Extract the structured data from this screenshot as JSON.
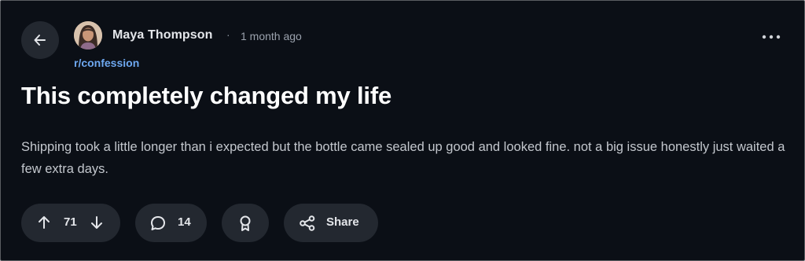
{
  "post": {
    "author": "Maya Thompson",
    "separator": "·",
    "time_ago": "1 month ago",
    "subreddit": "r/confession",
    "title": "This completely changed my life",
    "body": "Shipping took a little longer than i expected but the bottle came sealed up good and looked fine. not a big issue honestly just waited a few extra days."
  },
  "actions": {
    "score": "71",
    "comment_count": "14",
    "share_label": "Share"
  },
  "icons": {
    "back": "arrow-left-icon",
    "more": "more-horizontal-icon",
    "upvote": "arrow-up-icon",
    "downvote": "arrow-down-icon",
    "comment": "comment-bubble-icon",
    "award": "award-ribbon-icon",
    "share": "share-icon"
  },
  "colors": {
    "background": "#0b0f16",
    "pill": "#232830",
    "subreddit_link": "#6ea8f0",
    "title": "#ffffff",
    "body": "#c3c7cd"
  }
}
